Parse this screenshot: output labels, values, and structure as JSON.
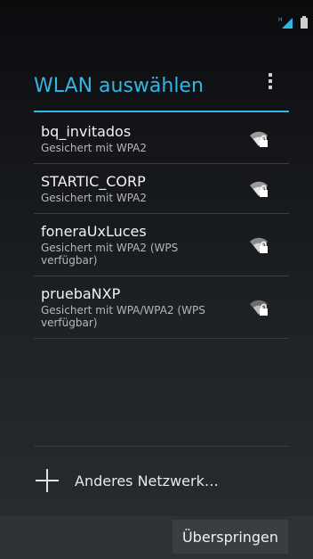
{
  "colors": {
    "accent": "#33b5e5",
    "background": "#1d2024",
    "divider": "#3a3d41",
    "button": "#3a3e43"
  },
  "statusbar": {
    "signal_icon": "signal-icon",
    "signal_label": "H",
    "battery_icon": "battery-icon"
  },
  "header": {
    "title": "WLAN auswählen",
    "overflow_icon": "overflow-menu-icon"
  },
  "networks": [
    {
      "name": "bq_invitados",
      "security": "Gesichert mit WPA2",
      "icon": "wifi-locked-icon"
    },
    {
      "name": "STARTIC_CORP",
      "security": "Gesichert mit WPA2",
      "icon": "wifi-locked-icon"
    },
    {
      "name": "foneraUxLuces",
      "security": "Gesichert mit WPA2 (WPS verfügbar)",
      "icon": "wifi-locked-icon"
    },
    {
      "name": "pruebaNXP",
      "security": "Gesichert mit WPA/WPA2 (WPS verfügbar)",
      "icon": "wifi-locked-icon"
    }
  ],
  "add_network": {
    "label": "Anderes Netzwerk…",
    "icon": "plus-icon"
  },
  "footer": {
    "skip_label": "Überspringen"
  }
}
